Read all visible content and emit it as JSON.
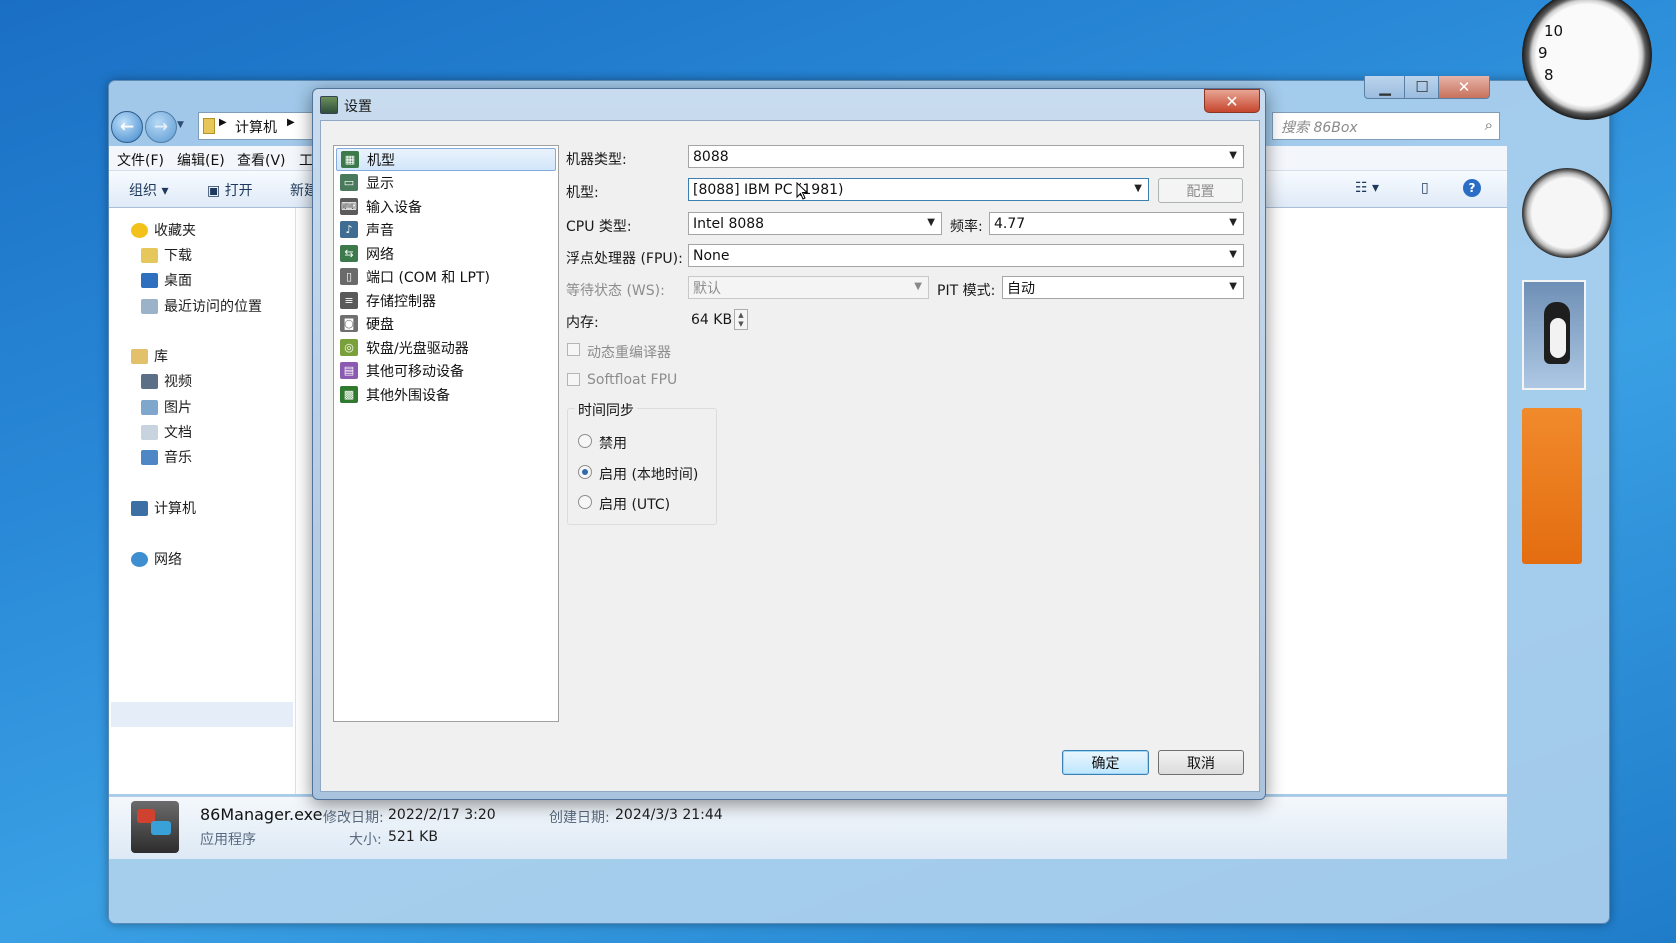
{
  "explorer": {
    "address_parts": [
      "计算机"
    ],
    "search_placeholder": "搜索 86Box",
    "menu": [
      "文件(F)",
      "编辑(E)",
      "查看(V)",
      "工"
    ],
    "toolbar": {
      "organize": "组织",
      "open": "打开",
      "new": "新建"
    },
    "nav": {
      "favorites": "收藏夹",
      "downloads": "下载",
      "desktop": "桌面",
      "recent": "最近访问的位置",
      "libraries": "库",
      "videos": "视频",
      "pictures": "图片",
      "documents": "文档",
      "music": "音乐",
      "computer": "计算机",
      "network": "网络"
    },
    "details": {
      "file_name": "86Manager.exe",
      "modified_label": "修改日期:",
      "modified_value": "2022/2/17 3:20",
      "created_label": "创建日期:",
      "created_value": "2024/3/3 21:44",
      "type": "应用程序",
      "size_label": "大小:",
      "size_value": "521 KB"
    }
  },
  "dialog": {
    "title": "设置",
    "categories": [
      {
        "label": "机型",
        "icon": "machine-icon",
        "color": "#3d7a4b"
      },
      {
        "label": "显示",
        "icon": "display-icon",
        "color": "#4a7a5c"
      },
      {
        "label": "输入设备",
        "icon": "input-devices-icon",
        "color": "#5b5b5b"
      },
      {
        "label": "声音",
        "icon": "sound-icon",
        "color": "#3e6c93"
      },
      {
        "label": "网络",
        "icon": "network-icon",
        "color": "#3d7a4b"
      },
      {
        "label": "端口 (COM 和 LPT)",
        "icon": "ports-icon",
        "color": "#6a6a6a"
      },
      {
        "label": "存储控制器",
        "icon": "storage-controller-icon",
        "color": "#5a5a5a"
      },
      {
        "label": "硬盘",
        "icon": "hard-disk-icon",
        "color": "#6f6f6f"
      },
      {
        "label": "软盘/光盘驱动器",
        "icon": "floppy-cdrom-icon",
        "color": "#7aa03c"
      },
      {
        "label": "其他可移动设备",
        "icon": "removable-devices-icon",
        "color": "#8a5bb0"
      },
      {
        "label": "其他外围设备",
        "icon": "other-peripherals-icon",
        "color": "#2f7a2f"
      }
    ],
    "selected_category": 0,
    "machine_type_label": "机器类型:",
    "machine_type_value": "8088",
    "machine_label": "机型:",
    "machine_value": "[8088] IBM PC (1981)",
    "configure_label": "配置",
    "cpu_type_label": "CPU 类型:",
    "cpu_type_value": "Intel 8088",
    "freq_label": "频率:",
    "freq_value": "4.77",
    "fpu_label": "浮点处理器 (FPU):",
    "fpu_value": "None",
    "wait_states_label": "等待状态 (WS):",
    "wait_states_value": "默认",
    "pit_mode_label": "PIT 模式:",
    "pit_mode_value": "自动",
    "memory_label": "内存:",
    "memory_value": "64 KB",
    "dynarec_label": "动态重编译器",
    "softfloat_label": "Softfloat FPU",
    "time_sync": {
      "title": "时间同步",
      "options": [
        "禁用",
        "启用 (本地时间)",
        "启用 (UTC)"
      ],
      "selected": 1
    },
    "ok_label": "确定",
    "cancel_label": "取消"
  },
  "gadgets": {
    "clock_numbers": [
      "10",
      "9",
      "8"
    ]
  }
}
